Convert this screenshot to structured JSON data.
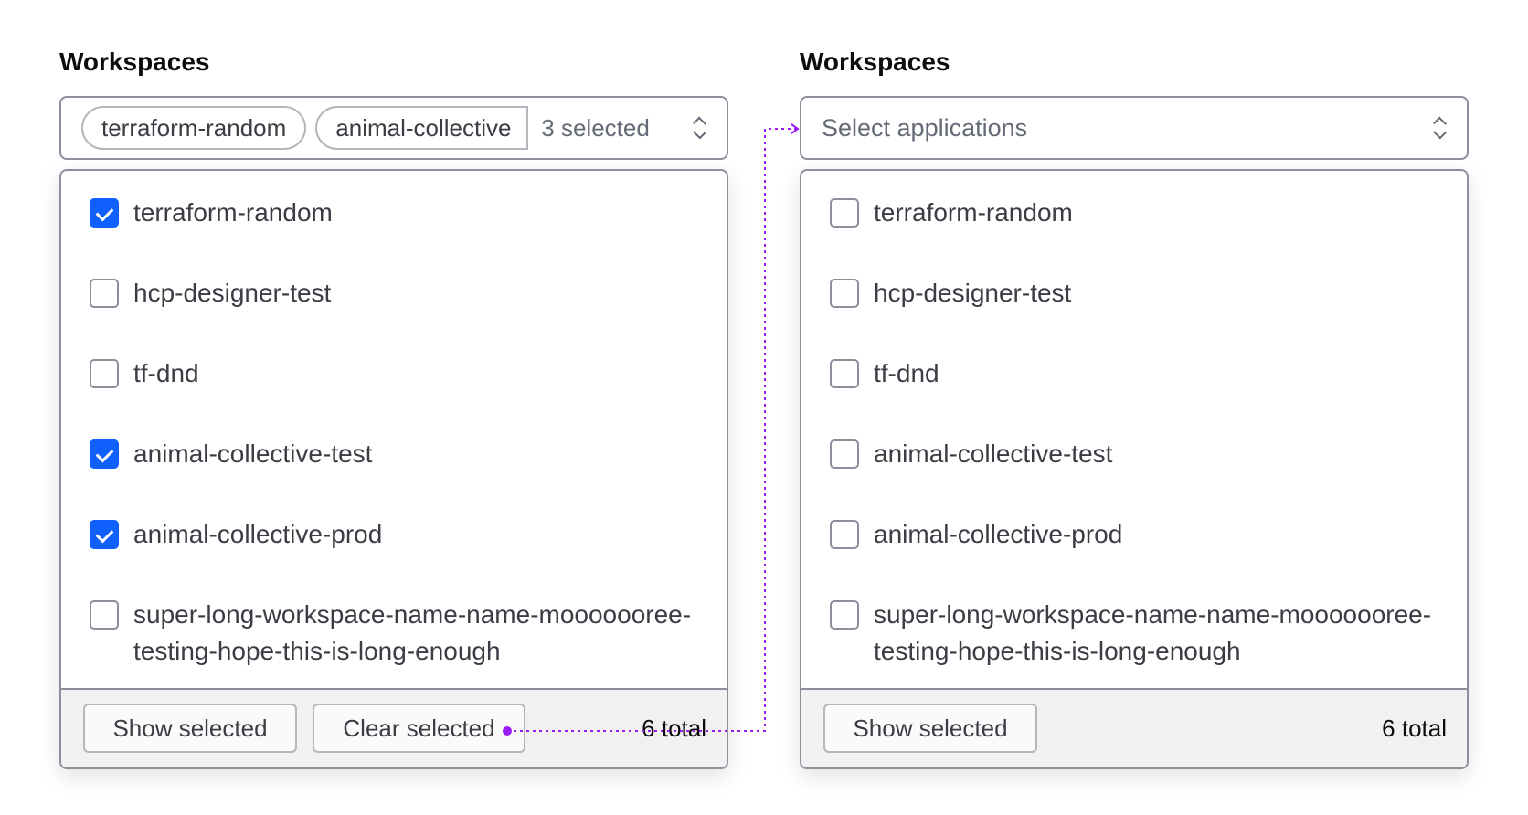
{
  "left": {
    "title": "Workspaces",
    "chips": [
      "terraform-random",
      "animal-collective"
    ],
    "selected_count": "3 selected",
    "items": [
      {
        "label": "terraform-random",
        "checked": true
      },
      {
        "label": "hcp-designer-test",
        "checked": false
      },
      {
        "label": "tf-dnd",
        "checked": false
      },
      {
        "label": "animal-collective-test",
        "checked": true
      },
      {
        "label": "animal-collective-prod",
        "checked": true
      },
      {
        "label": "super-long-workspace-name-name-mooooooree-testing-hope-this-is-long-enough",
        "checked": false
      }
    ],
    "show_selected": "Show selected",
    "clear_selected": "Clear selected",
    "total": "6 total"
  },
  "right": {
    "title": "Workspaces",
    "placeholder": "Select applications",
    "items": [
      {
        "label": "terraform-random",
        "checked": false
      },
      {
        "label": "hcp-designer-test",
        "checked": false
      },
      {
        "label": "tf-dnd",
        "checked": false
      },
      {
        "label": "animal-collective-test",
        "checked": false
      },
      {
        "label": "animal-collective-prod",
        "checked": false
      },
      {
        "label": "super-long-workspace-name-name-mooooooree-testing-hope-this-is-long-enough",
        "checked": false
      }
    ],
    "show_selected": "Show selected",
    "total": "6 total"
  },
  "colors": {
    "accent": "#1060ff",
    "annotation": "#9b1cf5"
  }
}
